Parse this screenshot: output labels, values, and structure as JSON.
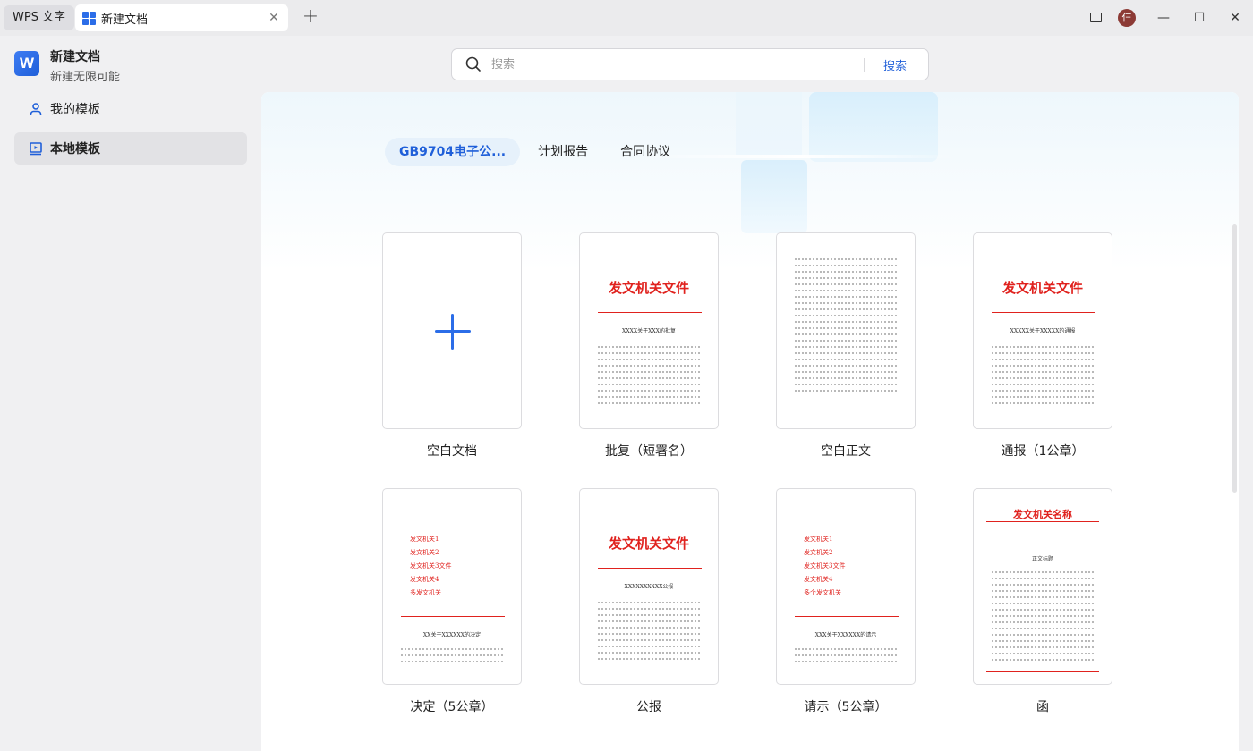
{
  "titlebar": {
    "app_tab": "WPS 文字",
    "doc_tab": "新建文档",
    "avatar_text": "仨"
  },
  "sidebar": {
    "title": "新建文档",
    "subtitle": "新建无限可能",
    "logo_letter": "W",
    "items": [
      {
        "label": "我的模板",
        "icon": "user-icon"
      },
      {
        "label": "本地模板",
        "icon": "local-template-icon",
        "active": true
      }
    ]
  },
  "search": {
    "placeholder": "搜索",
    "button": "搜索"
  },
  "tabs": [
    "GB9704电子公...",
    "计划报告",
    "合同协议"
  ],
  "templates": [
    {
      "label": "空白文档",
      "kind": "blank"
    },
    {
      "label": "批复（短署名）",
      "kind": "red-header",
      "header": "发文机关文件",
      "doc_title": "XXXX关于XXX的批复"
    },
    {
      "label": "空白正文",
      "kind": "text-only"
    },
    {
      "label": "通报（1公章）",
      "kind": "red-header",
      "header": "发文机关文件",
      "doc_title": "XXXXX关于XXXXX的通报"
    },
    {
      "label": "决定（5公章）",
      "kind": "red-multi",
      "rows": [
        "发文机关1",
        "发文机关2",
        "发文机关3文件",
        "发文机关4",
        "多发文机关"
      ],
      "doc_title": "XX关于XXXXXX的决定"
    },
    {
      "label": "公报",
      "kind": "red-header",
      "header": "发文机关文件",
      "doc_title": "XXXXXXXXXX公报"
    },
    {
      "label": "请示（5公章）",
      "kind": "red-multi",
      "rows": [
        "发文机关1",
        "发文机关2",
        "发文机关3文件",
        "发文机关4",
        "多个发文机关"
      ],
      "doc_title": "XXX关于XXXXXX的请示"
    },
    {
      "label": "函",
      "kind": "letter",
      "header": "发文机关名称",
      "doc_title": "正文标题"
    }
  ]
}
